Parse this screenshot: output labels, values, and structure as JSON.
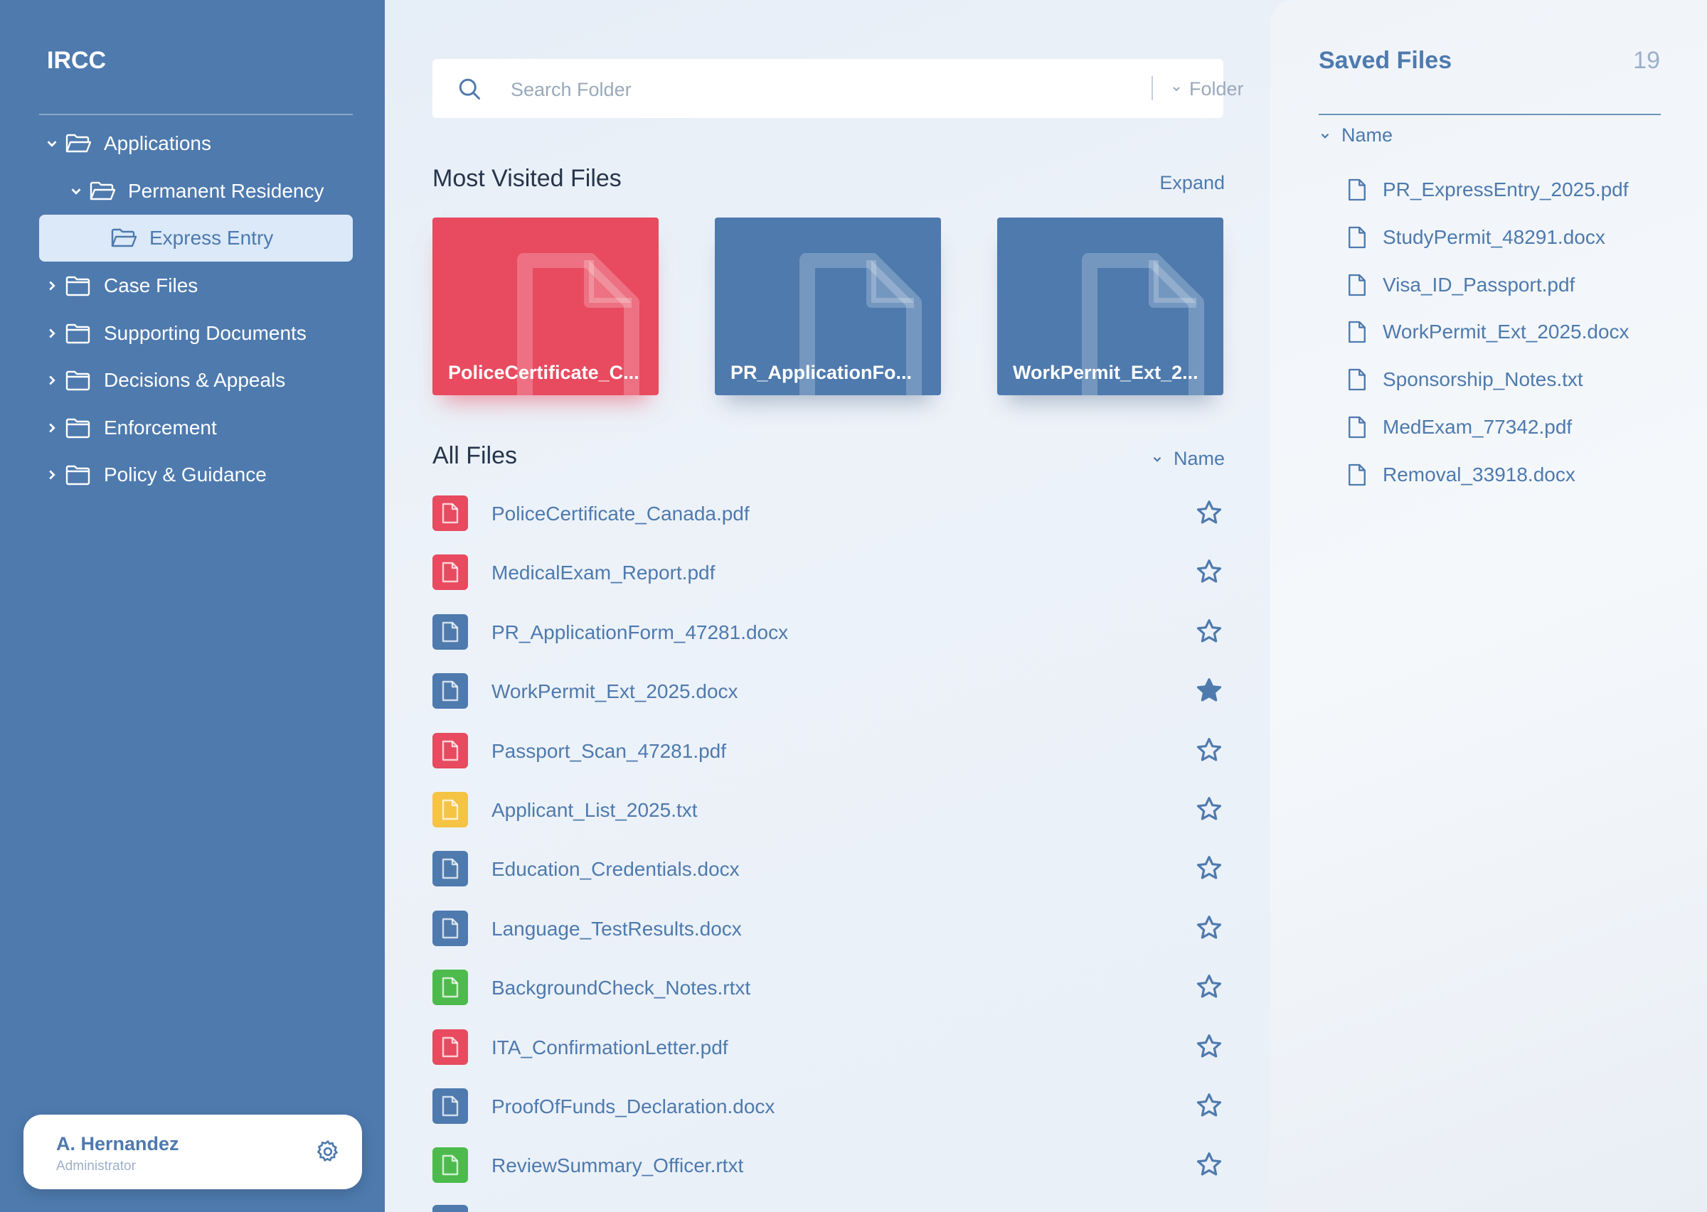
{
  "sidebar": {
    "brand": "IRCC",
    "tree": [
      {
        "label": "Applications",
        "level": 0,
        "chevron": "down",
        "folder": "open",
        "selected": false
      },
      {
        "label": "Permanent Residency",
        "level": 1,
        "chevron": "down",
        "folder": "open",
        "selected": false
      },
      {
        "label": "Express Entry",
        "level": 2,
        "chevron": "none",
        "folder": "open",
        "selected": true
      },
      {
        "label": "Case Files",
        "level": 0,
        "chevron": "right",
        "folder": "closed",
        "selected": false
      },
      {
        "label": "Supporting Documents",
        "level": 0,
        "chevron": "right",
        "folder": "closed",
        "selected": false
      },
      {
        "label": "Decisions & Appeals",
        "level": 0,
        "chevron": "right",
        "folder": "closed",
        "selected": false
      },
      {
        "label": "Enforcement",
        "level": 0,
        "chevron": "right",
        "folder": "closed",
        "selected": false
      },
      {
        "label": "Policy & Guidance",
        "level": 0,
        "chevron": "right",
        "folder": "closed",
        "selected": false
      }
    ],
    "user": {
      "name": "A. Hernandez",
      "role": "Administrator"
    }
  },
  "search": {
    "placeholder": "Search Folder",
    "scope": "Folder"
  },
  "most_visited": {
    "title": "Most Visited Files",
    "expand_label": "Expand",
    "cards": [
      {
        "label": "PoliceCertificate_C...",
        "color": "red"
      },
      {
        "label": "PR_ApplicationFo...",
        "color": "blue"
      },
      {
        "label": "WorkPermit_Ext_2...",
        "color": "blue"
      }
    ]
  },
  "all_files": {
    "title": "All Files",
    "sort_label": "Name",
    "files": [
      {
        "name": "PoliceCertificate_Canada.pdf",
        "type": "red",
        "starred": false
      },
      {
        "name": "MedicalExam_Report.pdf",
        "type": "red",
        "starred": false
      },
      {
        "name": "PR_ApplicationForm_47281.docx",
        "type": "blue",
        "starred": false
      },
      {
        "name": "WorkPermit_Ext_2025.docx",
        "type": "blue",
        "starred": true
      },
      {
        "name": "Passport_Scan_47281.pdf",
        "type": "red",
        "starred": false
      },
      {
        "name": "Applicant_List_2025.txt",
        "type": "yellow",
        "starred": false
      },
      {
        "name": "Education_Credentials.docx",
        "type": "blue",
        "starred": false
      },
      {
        "name": "Language_TestResults.docx",
        "type": "blue",
        "starred": false
      },
      {
        "name": "BackgroundCheck_Notes.rtxt",
        "type": "green",
        "starred": false
      },
      {
        "name": "ITA_ConfirmationLetter.pdf",
        "type": "red",
        "starred": false
      },
      {
        "name": "ProofOfFunds_Declaration.docx",
        "type": "blue",
        "starred": false
      },
      {
        "name": "ReviewSummary_Officer.rtxt",
        "type": "green",
        "starred": false
      }
    ]
  },
  "saved_files": {
    "title": "Saved Files",
    "count": "19",
    "sort_label": "Name",
    "items": [
      "PR_ExpressEntry_2025.pdf",
      "StudyPermit_48291.docx",
      "Visa_ID_Passport.pdf",
      "WorkPermit_Ext_2025.docx",
      "Sponsorship_Notes.txt",
      "MedExam_77342.pdf",
      "Removal_33918.docx"
    ]
  },
  "colors": {
    "primary": "#4e7aae",
    "red": "#e84a5f",
    "blue": "#4e7aae",
    "yellow": "#f6c443",
    "green": "#4cbb4c",
    "selected_bg": "#dbe9f8"
  }
}
